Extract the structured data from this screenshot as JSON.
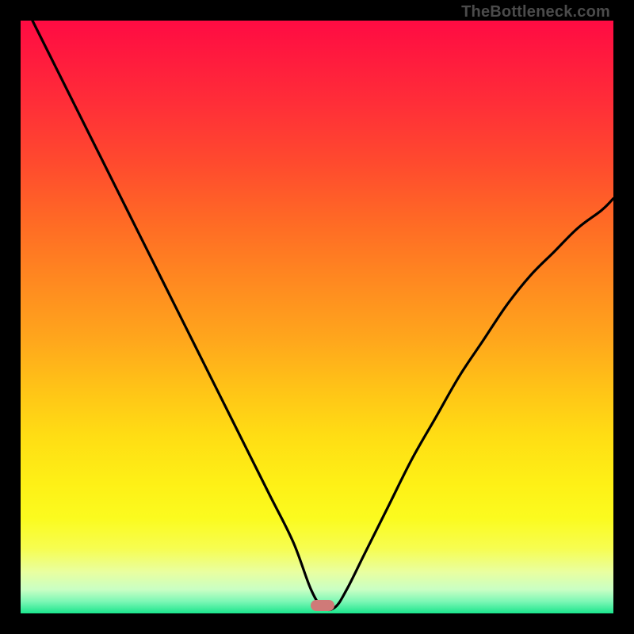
{
  "watermark": {
    "text": "TheBottleneck.com"
  },
  "chart_data": {
    "type": "line",
    "title": "",
    "xlabel": "",
    "ylabel": "",
    "xlim": [
      0,
      100
    ],
    "ylim": [
      0,
      100
    ],
    "grid": false,
    "legend": false,
    "series": [
      {
        "name": "bottleneck-curve",
        "x": [
          2,
          6,
          10,
          14,
          18,
          22,
          26,
          30,
          34,
          38,
          42,
          46,
          49,
          51,
          53,
          55,
          58,
          62,
          66,
          70,
          74,
          78,
          82,
          86,
          90,
          94,
          98,
          100
        ],
        "y": [
          100,
          92,
          84,
          76,
          68,
          60,
          52,
          44,
          36,
          28,
          20,
          12,
          4,
          1,
          1,
          4,
          10,
          18,
          26,
          33,
          40,
          46,
          52,
          57,
          61,
          65,
          68,
          70
        ]
      }
    ],
    "marker": {
      "x": 51,
      "y": 1.3,
      "color": "#cf7a78"
    },
    "gradient_stops": [
      {
        "pos": 0,
        "color": "#ff0b43"
      },
      {
        "pos": 50,
        "color": "#ff9a1e"
      },
      {
        "pos": 82,
        "color": "#fef016"
      },
      {
        "pos": 100,
        "color": "#1be58d"
      }
    ]
  }
}
